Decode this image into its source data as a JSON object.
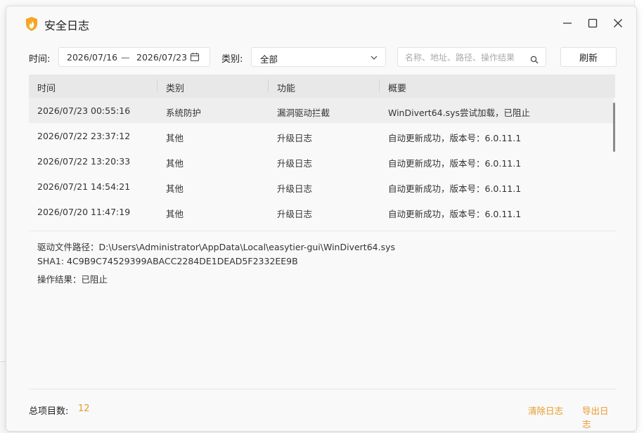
{
  "window": {
    "title": "安全日志"
  },
  "filters": {
    "time_label": "时间:",
    "date_start": "2026/07/16",
    "date_separator": "—",
    "date_end": "2026/07/23",
    "category_label": "类别:",
    "category_value": "全部",
    "search_placeholder": "名称、地址、路径、操作结果",
    "refresh_label": "刷新"
  },
  "table": {
    "headers": [
      "时间",
      "类别",
      "功能",
      "概要"
    ],
    "rows": [
      [
        "2026/07/23 00:55:16",
        "系统防护",
        "漏洞驱动拦截",
        "WinDivert64.sys尝试加载，已阻止"
      ],
      [
        "2026/07/22 23:37:12",
        "其他",
        "升级日志",
        "自动更新成功，版本号：6.0.11.1"
      ],
      [
        "2026/07/22 13:20:33",
        "其他",
        "升级日志",
        "自动更新成功，版本号：6.0.11.1"
      ],
      [
        "2026/07/21 14:54:21",
        "其他",
        "升级日志",
        "自动更新成功，版本号：6.0.11.1"
      ],
      [
        "2026/07/20 11:47:19",
        "其他",
        "升级日志",
        "自动更新成功，版本号：6.0.11.1"
      ]
    ]
  },
  "details": {
    "driver_path": "驱动文件路径：D:\\Users\\Administrator\\AppData\\Local\\easytier-gui\\WinDivert64.sys",
    "sha1": "SHA1: 4C9B9C74529399ABACC2284DE1DEAD5F2332EE9B",
    "result": "操作结果：已阻止"
  },
  "footer": {
    "total_label": "总项目数:",
    "total_count": "12",
    "clear_label": "清除日志",
    "export_label": "导出日志"
  },
  "colors": {
    "accent": "#e89a2c",
    "header_bg": "#e8e8e8",
    "selected_row": "#eeeeee"
  },
  "icons": {
    "app": "flame-shield-icon",
    "calendar": "calendar-icon",
    "chevron": "chevron-down-icon",
    "search": "search-icon",
    "minimize": "minimize-icon",
    "maximize": "maximize-icon",
    "close": "close-icon"
  }
}
